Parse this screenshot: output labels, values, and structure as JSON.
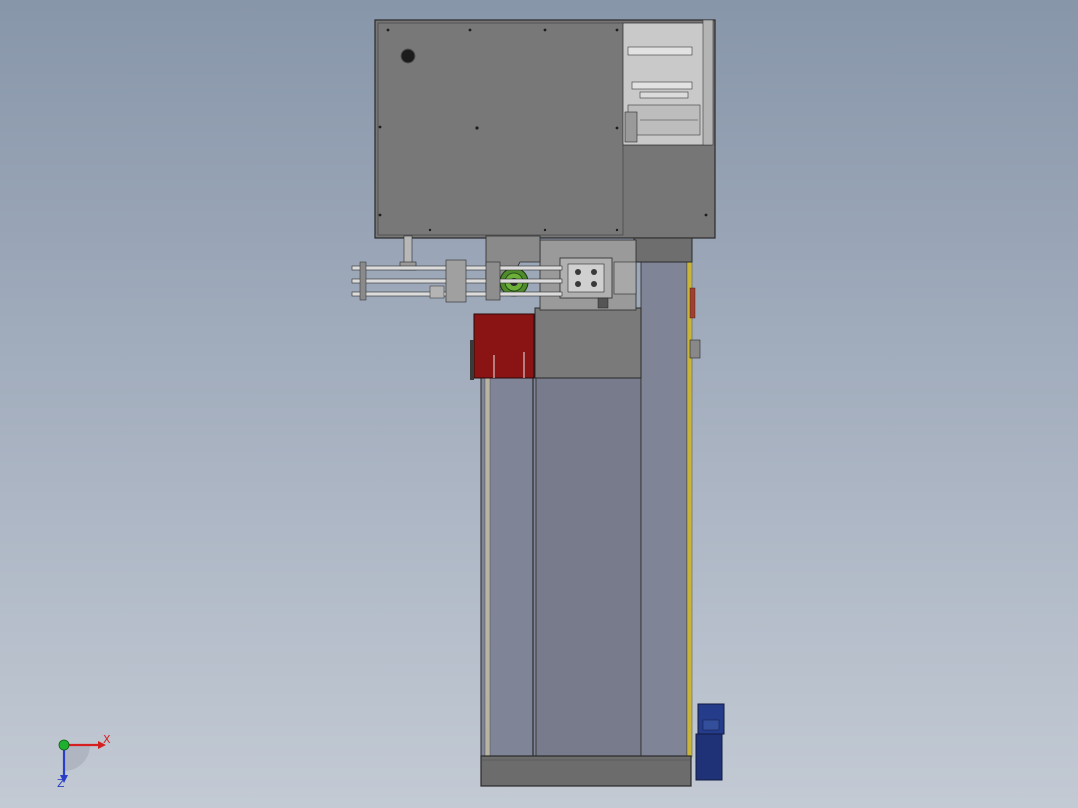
{
  "viewport": {
    "background_top": "#8896aa",
    "background_bottom": "#c3cad4"
  },
  "colors": {
    "panel_gray": "#767676",
    "frame_gray": "#6c6c6c",
    "column_blue_gray": "#7f8497",
    "cover_red": "#8a1414",
    "motor_blue": "#243c8a",
    "rail_yellow": "#c9b53a",
    "gear_green": "#5aa030",
    "edge": "#2a2a2a"
  },
  "model": {
    "parts": [
      "upper-control-cabinet",
      "cabinet-side-mechanism",
      "cylinder-assembly",
      "gear-drive",
      "clamp-block",
      "red-safety-cover",
      "gray-housing",
      "main-column",
      "base-plate",
      "drive-motor"
    ]
  },
  "triad": {
    "x_label": "X",
    "z_label": "Z",
    "x_color": "#d42020",
    "y_color": "#20b030",
    "z_color": "#2a3ec8"
  }
}
